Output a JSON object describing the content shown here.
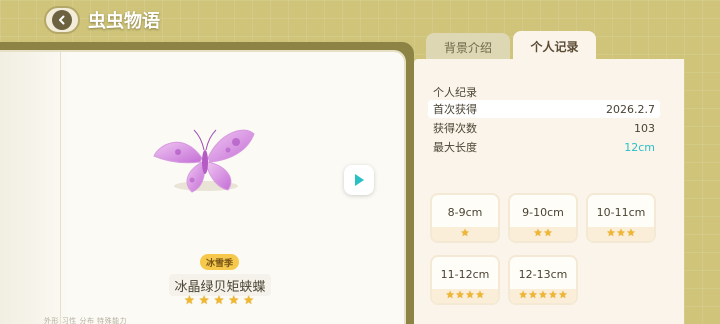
{
  "header": {
    "title": "虫虫物语"
  },
  "tabs": [
    {
      "label": "背景介绍",
      "active": false
    },
    {
      "label": "个人记录",
      "active": true
    }
  ],
  "bug": {
    "season_badge": "冰雪季",
    "name": "冰晶绿贝矩蛱蝶",
    "stars": 5,
    "footer": "外形 习性 分布 特殊能力"
  },
  "record": {
    "title": "个人纪录",
    "rows": [
      {
        "label": "首次获得",
        "value": "2026.2.7"
      },
      {
        "label": "获得次数",
        "value": "103"
      },
      {
        "label": "最大长度",
        "value": "12cm"
      }
    ]
  },
  "length_tiers": [
    {
      "label": "8-9cm",
      "stars": 1
    },
    {
      "label": "9-10cm",
      "stars": 2
    },
    {
      "label": "10-11cm",
      "stars": 3
    },
    {
      "label": "11-12cm",
      "stars": 4
    },
    {
      "label": "12-13cm",
      "stars": 5
    }
  ],
  "colors": {
    "accent_teal": "#2bbfc6",
    "star_gold": "#f0b72c",
    "badge_yellow": "#f6c94c",
    "background_olive": "#cfc47a"
  },
  "icons": {
    "back": "chevron-left-icon",
    "next": "play-right-icon",
    "star": "star-icon"
  }
}
